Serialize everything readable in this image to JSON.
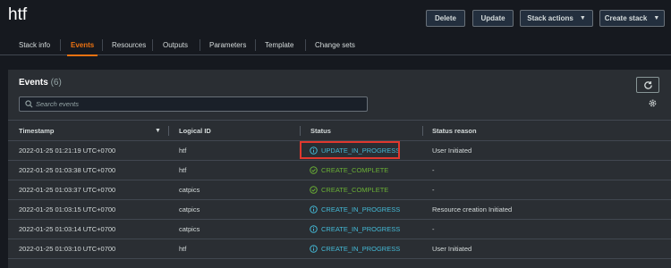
{
  "stack": {
    "name": "htf"
  },
  "actions": {
    "delete_label": "Delete",
    "update_label": "Update",
    "stack_actions_label": "Stack actions",
    "create_stack_label": "Create stack"
  },
  "tabs": [
    {
      "label": "Stack info"
    },
    {
      "label": "Events"
    },
    {
      "label": "Resources"
    },
    {
      "label": "Outputs"
    },
    {
      "label": "Parameters"
    },
    {
      "label": "Template"
    },
    {
      "label": "Change sets"
    }
  ],
  "active_tab": "Events",
  "events": {
    "title": "Events",
    "count": "(6)",
    "search_placeholder": "Search events"
  },
  "columns": {
    "timestamp": "Timestamp",
    "logical_id": "Logical ID",
    "status": "Status",
    "reason": "Status reason"
  },
  "rows": [
    {
      "timestamp": "2022-01-25 01:21:19 UTC+0700",
      "logical_id": "htf",
      "status": "UPDATE_IN_PROGRESS",
      "status_icon": "info-icon",
      "reason": "User Initiated"
    },
    {
      "timestamp": "2022-01-25 01:03:38 UTC+0700",
      "logical_id": "htf",
      "status": "CREATE_COMPLETE",
      "status_icon": "check-circle-icon",
      "reason": "-"
    },
    {
      "timestamp": "2022-01-25 01:03:37 UTC+0700",
      "logical_id": "catpics",
      "status": "CREATE_COMPLETE",
      "status_icon": "check-circle-icon",
      "reason": "-"
    },
    {
      "timestamp": "2022-01-25 01:03:15 UTC+0700",
      "logical_id": "catpics",
      "status": "CREATE_IN_PROGRESS",
      "status_icon": "info-icon",
      "reason": "Resource creation Initiated"
    },
    {
      "timestamp": "2022-01-25 01:03:14 UTC+0700",
      "logical_id": "catpics",
      "status": "CREATE_IN_PROGRESS",
      "status_icon": "info-icon",
      "reason": "-"
    },
    {
      "timestamp": "2022-01-25 01:03:10 UTC+0700",
      "logical_id": "htf",
      "status": "CREATE_IN_PROGRESS",
      "status_icon": "info-icon",
      "reason": "User Initiated"
    }
  ],
  "colors": {
    "accent": "#ec7211",
    "in_progress": "#44b9d6",
    "complete": "#6aaf35",
    "highlight": "#e0382e"
  }
}
